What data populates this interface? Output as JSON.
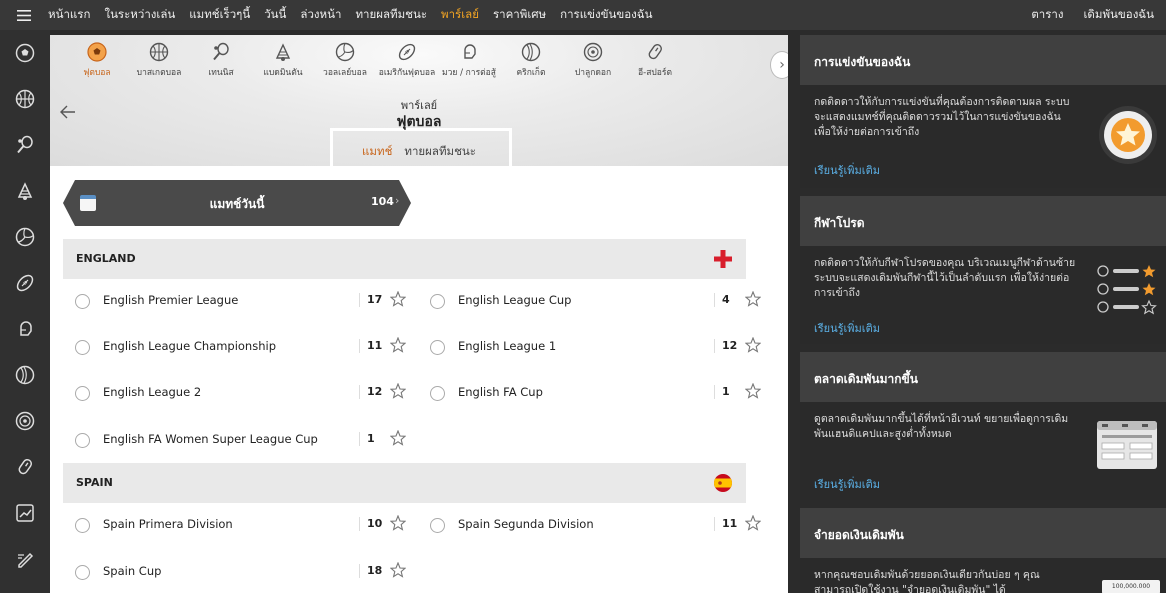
{
  "topnav": {
    "items": [
      "หน้าแรก",
      "ในระหว่างเล่น",
      "แมทช์เร็วๆนี้",
      "วันนี้",
      "ล่วงหน้า",
      "ทายผลทีมชนะ",
      "พาร์เลย์",
      "ราคาพิเศษ",
      "การแข่งขันของฉัน"
    ],
    "active_index": 6,
    "right_items": [
      "ตาราง",
      "เดิมพันของฉัน"
    ]
  },
  "sidebar": {
    "icons": [
      "soccer-icon",
      "basketball-icon",
      "tennis-icon",
      "badminton-icon",
      "volleyball-icon",
      "american-football-icon",
      "boxing-icon",
      "cricket-icon",
      "darts-icon",
      "esports-icon",
      "trending-icon",
      "pencil-icon"
    ]
  },
  "sports": {
    "items": [
      {
        "label": "ฟุตบอล",
        "icon": "soccer-icon"
      },
      {
        "label": "บาสเกตบอล",
        "icon": "basketball-icon"
      },
      {
        "label": "เทนนิส",
        "icon": "tennis-icon"
      },
      {
        "label": "แบดมินตัน",
        "icon": "badminton-icon"
      },
      {
        "label": "วอลเลย์บอล",
        "icon": "volleyball-icon"
      },
      {
        "label": "อเมริกันฟุตบอล",
        "icon": "american-football-icon"
      },
      {
        "label": "มวย / การต่อสู้",
        "icon": "boxing-icon"
      },
      {
        "label": "คริกเก็ต",
        "icon": "cricket-icon"
      },
      {
        "label": "ปาลูกดอก",
        "icon": "darts-icon"
      },
      {
        "label": "อี-สปอร์ต",
        "icon": "esports-icon"
      }
    ],
    "active_index": 0
  },
  "header": {
    "subtitle": "พาร์เลย์",
    "title": "ฟุตบอล",
    "tabs": [
      "แมทช์",
      "ทายผลทีมชนะ"
    ],
    "active_tab": 0
  },
  "banner": {
    "label": "แมทช์วันนี้",
    "count": "104"
  },
  "sections": [
    {
      "name": "ENGLAND",
      "flag": "england-flag",
      "leagues": [
        {
          "name": "English Premier League",
          "count": "17"
        },
        {
          "name": "English League Cup",
          "count": "4"
        },
        {
          "name": "English League Championship",
          "count": "11"
        },
        {
          "name": "English League 1",
          "count": "12"
        },
        {
          "name": "English League 2",
          "count": "12"
        },
        {
          "name": "English FA Cup",
          "count": "1"
        },
        {
          "name": "English FA Women Super League Cup",
          "count": "1"
        }
      ]
    },
    {
      "name": "SPAIN",
      "flag": "spain-flag",
      "leagues": [
        {
          "name": "Spain Primera Division",
          "count": "10"
        },
        {
          "name": "Spain Segunda Division",
          "count": "11"
        },
        {
          "name": "Spain Cup",
          "count": "18"
        }
      ]
    }
  ],
  "right": {
    "cards": [
      {
        "title": "การแข่งขันของฉัน",
        "body": "กดติดดาวให้กับการแข่งขันที่คุณต้องการติดตามผล ระบบจะแสดงแมทช์ที่คุณติดดาวรวมไว้ในการแข่งขันของฉัน เพื่อให้ง่ายต่อการเข้าถึง",
        "link": "เรียนรู้เพิ่มเติม"
      },
      {
        "title": "กีฬาโปรด",
        "body": "กดติดดาวให้กับกีฬาโปรดของคุณ บริเวณเมนูกีฬาด้านซ้าย ระบบจะแสดงเดิมพันกีฬานี้ไว้เป็นลำดับแรก เพื่อให้ง่ายต่อการเข้าถึง",
        "link": "เรียนรู้เพิ่มเติม"
      },
      {
        "title": "ตลาดเดิมพันมากขึ้น",
        "body": "ดูตลาดเดิมพันมากขึ้นได้ที่หน้าอีเวนท์ ขยายเพื่อดูการเดิมพันแฮนดิแคปและสูงต่ำทั้งหมด",
        "link": "เรียนรู้เพิ่มเติม"
      },
      {
        "title": "จำยอดเงินเดิมพัน",
        "body": "หากคุณชอบเดิมพันด้วยยอดเงินเดียวกันบ่อย ๆ คุณสามารถเปิดใช้งาน \"จำยอดเงินเดิมพัน\" ได้",
        "link": "",
        "amount": "100,000.000"
      }
    ]
  },
  "colors": {
    "accent": "#f5a623",
    "active_text": "#c8651b",
    "link": "#5bb0e6",
    "topbar": "#383838"
  }
}
